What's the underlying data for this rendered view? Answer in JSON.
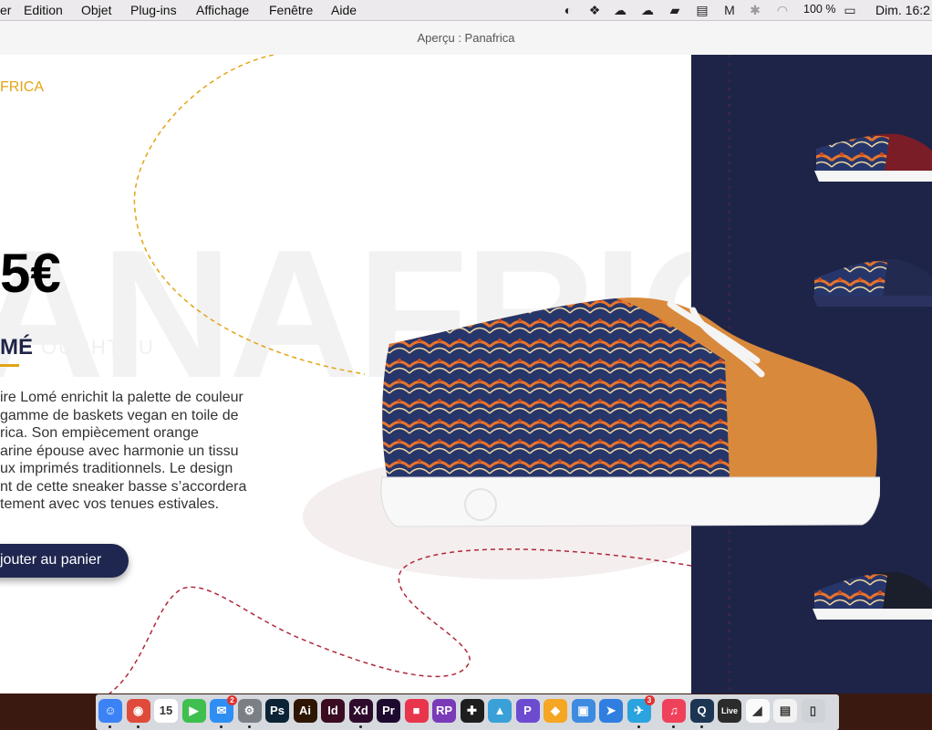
{
  "menubar": {
    "menus": [
      "er",
      "Edition",
      "Objet",
      "Plug-ins",
      "Affichage",
      "Fenêtre",
      "Aide"
    ],
    "battery": "100 %",
    "clock": "Dim. 16:2"
  },
  "window": {
    "title": "Aperçu : Panafrica"
  },
  "page": {
    "brand": "FRICA",
    "watermark": "ANAFRIC",
    "price": "5€",
    "model": "MÉ",
    "model_sub": "OUCHTOU",
    "description_lines": [
      "ire Lomé enrichit la palette de couleur",
      "gamme de baskets vegan en toile de",
      "rica. Son empiècement orange",
      "arine épouse avec harmonie un tissu",
      "ux imprimés traditionnels. Le design",
      "nt de cette sneaker basse s’accordera",
      "tement avec vos tenues estivales."
    ],
    "cart_button": "jouter au panier"
  },
  "dock": {
    "items": [
      {
        "name": "finder",
        "label": "☺",
        "color": "#3b82f6"
      },
      {
        "name": "chrome",
        "label": "◉",
        "color": "#e04a3a"
      },
      {
        "name": "calendar",
        "label": "15",
        "color": "#ffffff"
      },
      {
        "name": "facetime",
        "label": "▶",
        "color": "#3fbf4d"
      },
      {
        "name": "messages",
        "label": "✉",
        "color": "#2f8ef3"
      },
      {
        "name": "system-preferences",
        "label": "⚙",
        "color": "#7b7f86"
      },
      {
        "name": "photoshop",
        "label": "Ps",
        "color": "#0b2334"
      },
      {
        "name": "illustrator",
        "label": "Ai",
        "color": "#2d1604"
      },
      {
        "name": "indesign",
        "label": "Id",
        "color": "#3a0b23"
      },
      {
        "name": "xd",
        "label": "Xd",
        "color": "#2e0b2d"
      },
      {
        "name": "premiere",
        "label": "Pr",
        "color": "#1d0a2e"
      },
      {
        "name": "app-red",
        "label": "■",
        "color": "#e8354c"
      },
      {
        "name": "rp",
        "label": "RP",
        "color": "#7a3ab8"
      },
      {
        "name": "figma",
        "label": "✚",
        "color": "#1e1e1e"
      },
      {
        "name": "affinity",
        "label": "▲",
        "color": "#39a1d8"
      },
      {
        "name": "p-app",
        "label": "P",
        "color": "#6c4bd1"
      },
      {
        "name": "sketch",
        "label": "◆",
        "color": "#f5a623"
      },
      {
        "name": "preview-app",
        "label": "▣",
        "color": "#3d8be0"
      },
      {
        "name": "paperplane",
        "label": "➤",
        "color": "#2f7ee0"
      },
      {
        "name": "telegram",
        "label": "✈",
        "color": "#2aa3df"
      },
      {
        "name": "music",
        "label": "♫",
        "color": "#f0415a"
      },
      {
        "name": "quicktime",
        "label": "Q",
        "color": "#1b3552"
      },
      {
        "name": "live",
        "label": "Live",
        "color": "#2b2b2b"
      },
      {
        "name": "shoe-app",
        "label": "◢",
        "color": "#fafafa"
      },
      {
        "name": "window-app",
        "label": "▤",
        "color": "#f2f2f2"
      },
      {
        "name": "trash",
        "label": "▯",
        "color": "#cfd3d8"
      }
    ],
    "messages_badge": "2",
    "telegram_badge": "3",
    "calendar_day": "15"
  }
}
